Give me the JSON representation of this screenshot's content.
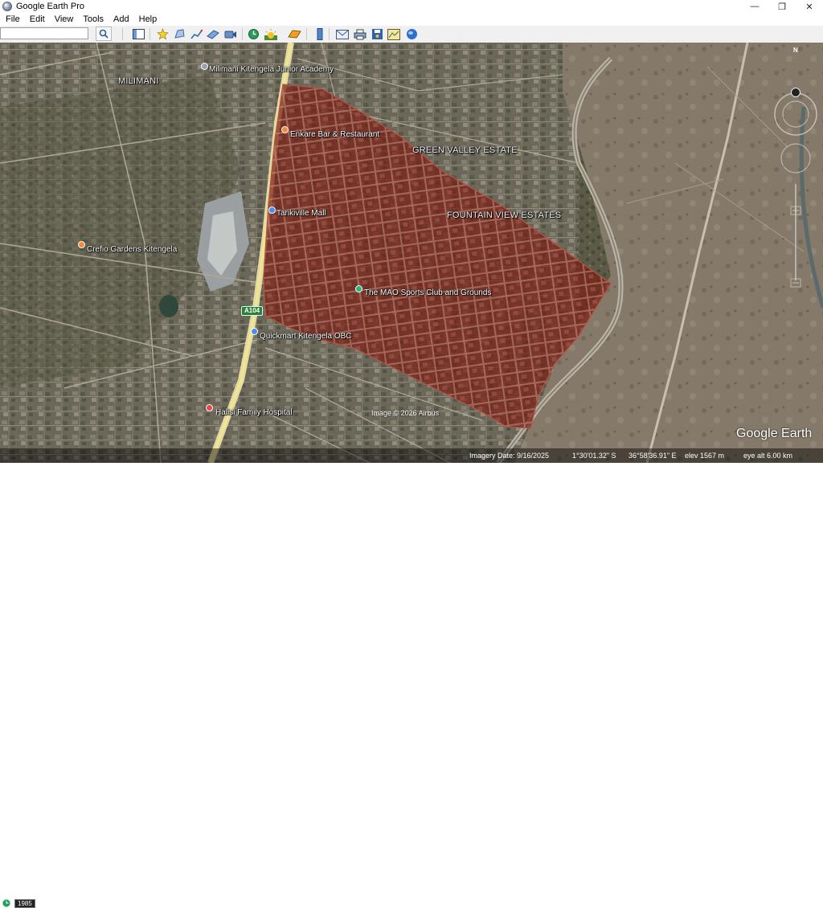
{
  "window": {
    "title": "Google Earth Pro",
    "controls": {
      "minimize": "—",
      "maximize": "❐",
      "close": "✕"
    }
  },
  "menu": [
    "File",
    "Edit",
    "View",
    "Tools",
    "Add",
    "Help"
  ],
  "search": {
    "value": ""
  },
  "toolbar": {
    "icons": [
      "sidebar-icon",
      "placemark-icon",
      "polygon-icon",
      "path-icon",
      "image-overlay-icon",
      "record-tour-icon",
      "historical-imagery-icon",
      "sunlight-icon",
      "planets-icon",
      "ruler-icon",
      "email-icon",
      "print-icon",
      "save-image-icon",
      "view-in-maps-icon",
      "earth-gallery-icon"
    ]
  },
  "map": {
    "areas": [
      "MILIMANI",
      "GREEN VALLEY ESTATE",
      "FOUNTAIN VIEW ESTATES"
    ],
    "places": [
      {
        "name": "Milimani Kitengela Junior Academy",
        "type": "school"
      },
      {
        "name": "Enkare Bar & Restaurant",
        "type": "restaurant"
      },
      {
        "name": "Tarikiville Mall",
        "type": "shopping"
      },
      {
        "name": "Crefio Gardens Kitengela",
        "type": "food"
      },
      {
        "name": "The MAO Sports Club and Grounds",
        "type": "park"
      },
      {
        "name": "Quickmart Kitengela OBC",
        "type": "shopping"
      },
      {
        "name": "Halisi Family Hospital",
        "type": "hospital"
      }
    ],
    "road_label": "A104",
    "credit": "Image © 2026 Airbus",
    "watermark": "Google Earth",
    "compass_label": "N",
    "polygon_color": "#7a1f14"
  },
  "status": {
    "history_year": "1985",
    "imagery_date": "Imagery Date: 9/16/2025",
    "lat": "1°30'01.32\" S",
    "lon": "36°58'36.91\" E",
    "elev": "elev  1567 m",
    "eye_alt": "eye alt   6.00 km"
  }
}
